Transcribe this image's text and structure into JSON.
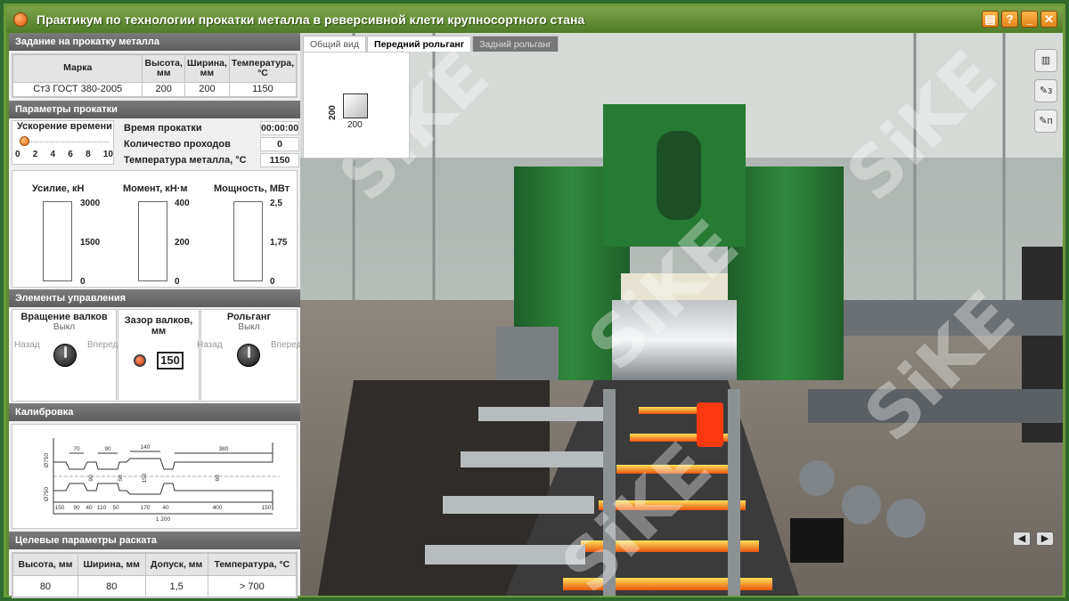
{
  "window": {
    "title": "Практикум по технологии прокатки металла в реверсивной клети крупносортного стана",
    "buttons": [
      "doc-icon",
      "help-icon",
      "minimize-icon",
      "close-icon"
    ]
  },
  "task": {
    "header": "Задание на прокатку металла",
    "columns": [
      "Марка",
      "Высота, мм",
      "Ширина, мм",
      "Температура, °С"
    ],
    "row": [
      "Ст3 ГОСТ 380-2005",
      "200",
      "200",
      "1150"
    ]
  },
  "params": {
    "header": "Параметры прокатки",
    "accel_label": "Ускорение времени",
    "accel_ticks": [
      "0",
      "2",
      "4",
      "6",
      "8",
      "10"
    ],
    "accel_value": 1,
    "rows": [
      {
        "label": "Время прокатки",
        "value": "00:00:00"
      },
      {
        "label": "Количество проходов",
        "value": "0"
      },
      {
        "label": "Температура металла, °С",
        "value": "1150"
      }
    ],
    "gauges": [
      {
        "title": "Усилие, кН",
        "max": "3000",
        "mid": "1500",
        "min": "0"
      },
      {
        "title": "Момент, кН·м",
        "max": "400",
        "mid": "200",
        "min": "0"
      },
      {
        "title": "Мощность, МВт",
        "max": "2,5",
        "mid": "1,75",
        "min": "0"
      }
    ]
  },
  "controls": {
    "header": "Элементы управления",
    "rotation": {
      "title": "Вращение валков",
      "state": "Выкл",
      "back": "Назад",
      "forward": "Вперед"
    },
    "gap": {
      "title": "Зазор валков, мм",
      "value": "150"
    },
    "roller": {
      "title": "Рольганг",
      "state": "Выкл",
      "back": "Назад",
      "forward": "Вперед"
    }
  },
  "calibration": {
    "header": "Калибровка",
    "top_dims": [
      "70",
      "90",
      "140",
      "380"
    ],
    "bottom_dims": [
      "150",
      "90",
      "40",
      "110",
      "50",
      "170",
      "40",
      "400",
      "150"
    ],
    "total": "1 200",
    "left_dims": [
      "Ø750",
      "Ø750"
    ],
    "inner_dims": [
      "90",
      "50",
      "150",
      "60"
    ]
  },
  "target": {
    "header": "Целевые параметры раската",
    "columns": [
      "Высота, мм",
      "Ширина, мм",
      "Допуск, мм",
      "Температура, °С"
    ],
    "row": [
      "80",
      "80",
      "1,5",
      "> 700"
    ]
  },
  "viewport": {
    "tabs": [
      "Общий вид",
      "Передний рольганг",
      "Задний рольганг"
    ],
    "active_tab": 1,
    "section_h": "200",
    "section_w": "200",
    "tools": [
      "ruler-icon",
      "caliper-z-icon",
      "caliper-p-icon"
    ],
    "watermark": "SiKE"
  }
}
